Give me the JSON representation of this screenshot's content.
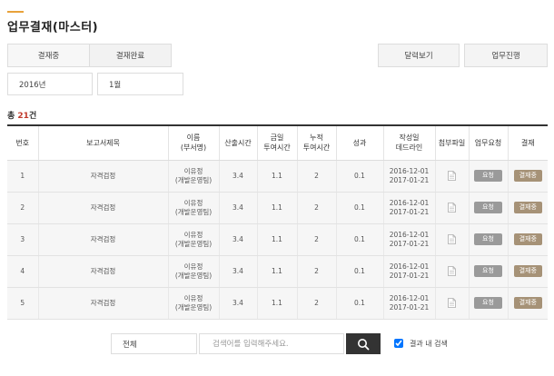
{
  "page": {
    "title": "업무결재(마스터)"
  },
  "tabs": [
    {
      "label": "결재중",
      "active": true
    },
    {
      "label": "결재완료",
      "active": false
    }
  ],
  "view_buttons": {
    "calendar": "달력보기",
    "progress": "업무진행"
  },
  "filters": {
    "year": "2016년",
    "month": "1월"
  },
  "total": {
    "prefix": "총 ",
    "count": "21",
    "suffix": "건"
  },
  "table": {
    "headers": {
      "no": "번호",
      "report_title": "보고서제목",
      "name_line1": "이름",
      "name_line2": "(부서명)",
      "hours": "산출시간",
      "today_line1": "금일",
      "today_line2": "투여시간",
      "cumulative_line1": "누적",
      "cumulative_line2": "투여시간",
      "result": "성과",
      "date_line1": "작성일",
      "date_line2": "데드라인",
      "attachment": "첨부파일",
      "request": "업무요청",
      "approval": "결재"
    },
    "rows": [
      {
        "no": "1",
        "title": "자격검정",
        "name": "이유정",
        "dept": "(개발운영팀)",
        "hours": "3.4",
        "today": "1.1",
        "cumulative": "2",
        "result": "0.1",
        "written": "2016-12-01",
        "deadline": "2017-01-21",
        "request_label": "요청",
        "approval_label": "결재중"
      },
      {
        "no": "2",
        "title": "자격검정",
        "name": "이유정",
        "dept": "(개발운영팀)",
        "hours": "3.4",
        "today": "1.1",
        "cumulative": "2",
        "result": "0.1",
        "written": "2016-12-01",
        "deadline": "2017-01-21",
        "request_label": "요청",
        "approval_label": "결재중"
      },
      {
        "no": "3",
        "title": "자격검정",
        "name": "이유정",
        "dept": "(개발운영팀)",
        "hours": "3.4",
        "today": "1.1",
        "cumulative": "2",
        "result": "0.1",
        "written": "2016-12-01",
        "deadline": "2017-01-21",
        "request_label": "요청",
        "approval_label": "결재중"
      },
      {
        "no": "4",
        "title": "자격검정",
        "name": "이유정",
        "dept": "(개발운영팀)",
        "hours": "3.4",
        "today": "1.1",
        "cumulative": "2",
        "result": "0.1",
        "written": "2016-12-01",
        "deadline": "2017-01-21",
        "request_label": "요청",
        "approval_label": "결재중"
      },
      {
        "no": "5",
        "title": "자격검정",
        "name": "이유정",
        "dept": "(개발운영팀)",
        "hours": "3.4",
        "today": "1.1",
        "cumulative": "2",
        "result": "0.1",
        "written": "2016-12-01",
        "deadline": "2017-01-21",
        "request_label": "요청",
        "approval_label": "결재중"
      }
    ]
  },
  "search": {
    "scope": "전체",
    "placeholder": "검색어를 입력해주세요.",
    "within_results_label": "결과 내 검색",
    "within_results_checked": true
  },
  "icons": {
    "attachment": "document-icon",
    "search": "magnifier-icon"
  },
  "colors": {
    "accent": "#e8a23a",
    "total_count": "#c0392b",
    "request_button": "#9a9a9a",
    "approval_button": "#a69277",
    "search_button": "#333333"
  }
}
